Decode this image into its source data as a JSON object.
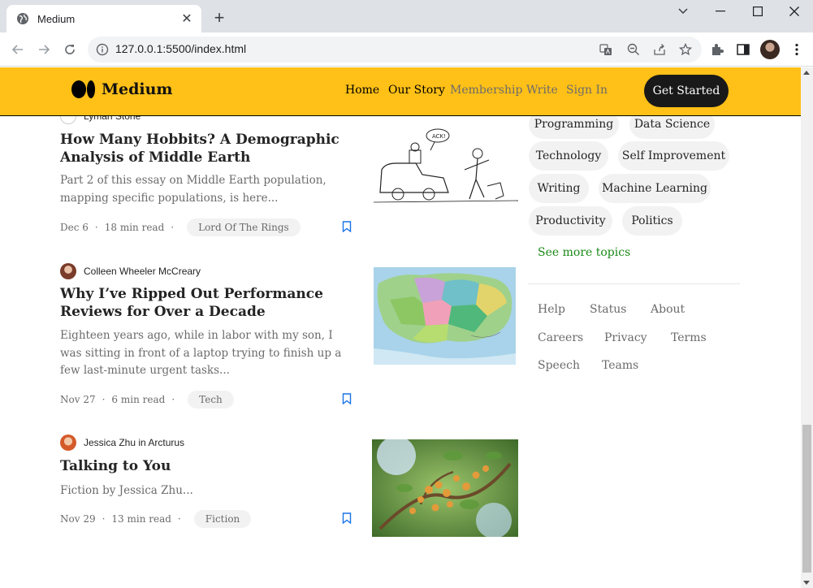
{
  "browser": {
    "tab_title": "Medium",
    "url": "127.0.0.1:5500/index.html"
  },
  "header": {
    "logo_text": "Medium",
    "nav": [
      "Home",
      "Our Story",
      "Membership",
      "Write",
      "Sign In"
    ],
    "cta": "Get Started",
    "brand_color": "#ffc017"
  },
  "articles": [
    {
      "author": "Lyman Stone",
      "title": "How Many Hobbits? A Demographic Analysis of Middle Earth",
      "description": "Part 2 of this essay on Middle Earth population, mapping specific populations, is here...",
      "date": "Dec 6",
      "read_time": "18 min read",
      "tag": "Lord Of The Rings"
    },
    {
      "author": "Colleen Wheeler McCreary",
      "title": "Why I’ve Ripped Out Performance Reviews for Over a Decade",
      "description": "Eighteen years ago, while in labor with my son, I was sitting in front of a laptop trying to finish up a few last-minute urgent tasks...",
      "date": "Nov 27",
      "read_time": "6 min read",
      "tag": "Tech"
    },
    {
      "author": "Jessica Zhu in Arcturus",
      "title": "Talking to You",
      "description": "Fiction by Jessica Zhu...",
      "date": "Nov 29",
      "read_time": "13 min read",
      "tag": "Fiction"
    }
  ],
  "sidebar": {
    "topics": [
      "Programming",
      "Data Science",
      "Technology",
      "Self Improvement",
      "Writing",
      "Machine Learning",
      "Productivity",
      "Politics"
    ],
    "see_more": "See more topics",
    "footer_links": [
      "Help",
      "Status",
      "About",
      "Careers",
      "Privacy",
      "Terms",
      "Speech",
      "Teams"
    ]
  },
  "comic_text": "ACK!",
  "dot": "·"
}
